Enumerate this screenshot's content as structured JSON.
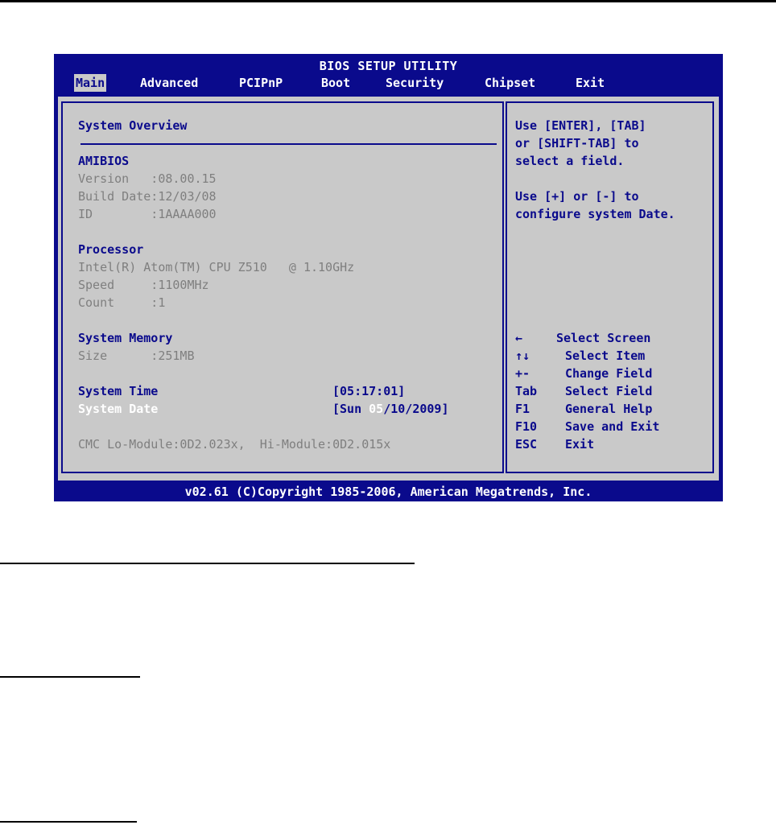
{
  "bios": {
    "title": "BIOS SETUP UTILITY",
    "menu": [
      "Main",
      "Advanced",
      "PCIPnP",
      "Boot",
      "Security",
      "Chipset",
      "Exit"
    ],
    "active_menu": "Main",
    "section_title": "System Overview",
    "amibios": {
      "heading": "AMIBIOS",
      "version": "Version   :08.00.15",
      "build_date": "Build Date:12/03/08",
      "id": "ID        :1AAAA000"
    },
    "processor": {
      "heading": "Processor",
      "cpu": "Intel(R) Atom(TM) CPU Z510   @ 1.10GHz",
      "speed": "Speed     :1100MHz",
      "count": "Count     :1"
    },
    "memory": {
      "heading": "System Memory",
      "size": "Size      :251MB"
    },
    "system_time": {
      "label": "System Time",
      "value": "[05:17:01]"
    },
    "system_date": {
      "label": "System Date",
      "prefix": "[Sun ",
      "month": "05",
      "suffix": "/10/2009]"
    },
    "cmc": "CMC Lo-Module:0D2.023x,  Hi-Module:0D2.015x",
    "help": {
      "line1": "Use [ENTER], [TAB]",
      "line2": "or [SHIFT-TAB] to",
      "line3": "select a field.",
      "line4": "Use [+] or [-] to",
      "line5": "configure system Date."
    },
    "keys": [
      {
        "key": "←",
        "desc": "Select Screen"
      },
      {
        "key": "↑↓",
        "desc": "Select Item"
      },
      {
        "key": "+-",
        "desc": "Change Field"
      },
      {
        "key": "Tab",
        "desc": "Select Field"
      },
      {
        "key": "F1",
        "desc": "General Help"
      },
      {
        "key": "F10",
        "desc": "Save and Exit"
      },
      {
        "key": "ESC",
        "desc": "Exit"
      }
    ],
    "footer": "v02.61 (C)Copyright 1985-2006, American Megatrends, Inc.",
    "colors": {
      "background": "#0a0a8c",
      "panel": "#c9c9c9",
      "accent_text": "#0a0a8c",
      "dim_text": "#7f7f7f",
      "highlight": "#ffffff"
    }
  }
}
